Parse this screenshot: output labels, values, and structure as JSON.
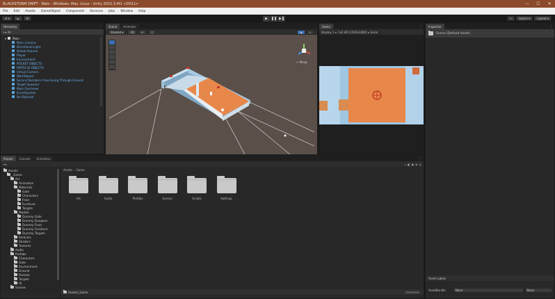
{
  "window": {
    "title": "BLACKSTORM DRIFT - Main - Windows, Mac, Linux - Unity 2022.3.4f1 <DX11>",
    "controls": [
      "—",
      "☐",
      "✕"
    ]
  },
  "menu": [
    "File",
    "Edit",
    "Assets",
    "GameObject",
    "Component",
    "Services",
    "Jobs",
    "Window",
    "Help"
  ],
  "toolbar": {
    "left": [
      "⊕ ▾",
      "☁",
      "⚙"
    ],
    "play": [
      "▶",
      "❚❚",
      "▶❚"
    ],
    "right": [
      "⌕",
      "Layers ▾",
      "Layout ▾"
    ]
  },
  "hierarchy": {
    "tab": "Hierarchy",
    "search_placeholder": "All",
    "scene": "Main",
    "items": [
      "Main Camera",
      "Directional Light",
      "Global Volume",
      "Player",
      "Environment",
      "POCKET OBJECTS",
      "PARTICLE OBJECTS",
      "Virtual Camera",
      "WorldSpace",
      "Second Numbers Flow Going Through Ground",
      "Target Spawner",
      "Main Overview",
      "EventSystem",
      "No Objectal"
    ]
  },
  "scene_view": {
    "tabs": [
      "Scene",
      "Animator"
    ],
    "left_tools": [
      "Shaded ▾",
      "2D",
      "☀",
      "♫"
    ],
    "gizmo_label": "< Persp"
  },
  "game_view": {
    "tab": "Game",
    "display": "Display 1 ▾",
    "aspect": "Full HD (1920x1080) ▾",
    "scale": "Scale"
  },
  "inspector": {
    "tab": "Inspector",
    "title": "Scene (Default Asset)",
    "asset_labels": "Asset Labels",
    "assetbundle_label": "AssetBundle",
    "assetbundle_value": "None",
    "variant_value": "None"
  },
  "project": {
    "tabs": [
      "Project",
      "Console",
      "Animation"
    ],
    "breadcrumb": [
      "Assets",
      "Game"
    ],
    "bottom_path": "Assets/_Game",
    "tree": [
      {
        "label": "Assets",
        "depth": 0
      },
      {
        "label": "_Game",
        "depth": 1
      },
      {
        "label": "Art",
        "depth": 2
      },
      {
        "label": "Animation",
        "depth": 3
      },
      {
        "label": "Materials",
        "depth": 3
      },
      {
        "label": "Gate",
        "depth": 4
      },
      {
        "label": "Characters",
        "depth": 4
      },
      {
        "label": "Floor",
        "depth": 4
      },
      {
        "label": "Furniture",
        "depth": 4
      },
      {
        "label": "Targets",
        "depth": 4
      },
      {
        "label": "Models",
        "depth": 3
      },
      {
        "label": "Dummy Gate",
        "depth": 4
      },
      {
        "label": "Dummy Dungeon",
        "depth": 4
      },
      {
        "label": "Dummy Floor",
        "depth": 4
      },
      {
        "label": "Dummy Furniture",
        "depth": 4
      },
      {
        "label": "Dummy Targets",
        "depth": 4
      },
      {
        "label": "Particles",
        "depth": 3
      },
      {
        "label": "Shaders",
        "depth": 3
      },
      {
        "label": "Textures",
        "depth": 3
      },
      {
        "label": "Audio",
        "depth": 2
      },
      {
        "label": "Prefabs",
        "depth": 2
      },
      {
        "label": "Characters",
        "depth": 3
      },
      {
        "label": "Gate",
        "depth": 3
      },
      {
        "label": "Environment",
        "depth": 3
      },
      {
        "label": "Ground",
        "depth": 3
      },
      {
        "label": "Pockets",
        "depth": 3
      },
      {
        "label": "Targets",
        "depth": 3
      },
      {
        "label": "UI",
        "depth": 3
      },
      {
        "label": "Scenes",
        "depth": 2
      }
    ],
    "folders": [
      "Art",
      "Audio",
      "Prefabs",
      "Scenes",
      "Scripts",
      "Settings"
    ]
  },
  "colors": {
    "title_bar": "#8b4a2b",
    "floor": "#e8874a",
    "walls": "#b9d9ee",
    "selection": "#5aa6e0"
  }
}
